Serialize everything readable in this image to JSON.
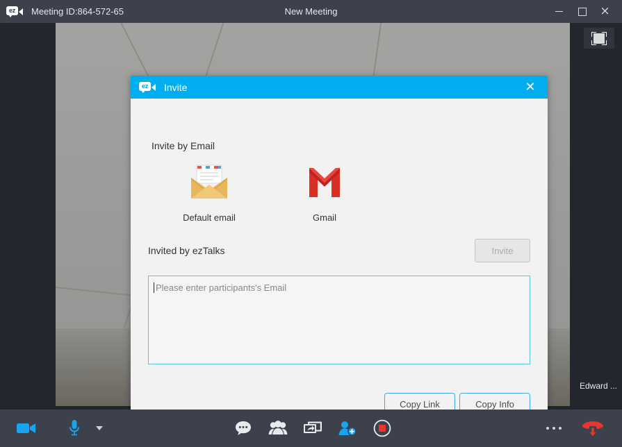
{
  "window": {
    "meeting_id_label": "Meeting ID:864-572-65",
    "title": "New Meeting",
    "logo_text": "ez",
    "controls": {
      "minimize": "minimize-button",
      "maximize": "maximize-button",
      "close": "×"
    }
  },
  "stage": {
    "self_view_name": "Edward ...",
    "thumbnail_toggle_name": "gallery-view-toggle"
  },
  "dialog": {
    "logo_text": "ez",
    "title": "Invite",
    "close_label": "✕",
    "section_label": "Invite by Email",
    "mail_options": [
      {
        "label": "Default email",
        "icon": "default-email-icon"
      },
      {
        "label": "Gmail",
        "icon": "gmail-icon"
      }
    ],
    "invited_by_label": "Invited by ezTalks",
    "invite_button_label": "Invite",
    "invite_button_disabled": true,
    "email_placeholder": "Please enter participants's Email",
    "email_value": "",
    "footer_buttons": [
      {
        "label": "Copy Link"
      },
      {
        "label": "Copy Info"
      }
    ]
  },
  "toolbar": {
    "video_icon": "camera-icon",
    "audio_icon": "microphone-icon",
    "audio_menu_icon": "chevron-down-icon",
    "center_items": [
      {
        "name": "chat-icon"
      },
      {
        "name": "participants-icon"
      },
      {
        "name": "share-screen-icon"
      },
      {
        "name": "invite-icon"
      },
      {
        "name": "record-icon"
      }
    ],
    "more_icon": "more-options-icon",
    "end_call_icon": "end-call-icon"
  },
  "colors": {
    "accent_blue": "#00adef",
    "titlebar_bg": "#3c414c",
    "dialog_bg": "#f2f2f2",
    "input_border": "#5bc2e0",
    "outline_button_border": "#3ea9dd",
    "record_red": "#e8352e",
    "end_call_red": "#e8352e"
  }
}
